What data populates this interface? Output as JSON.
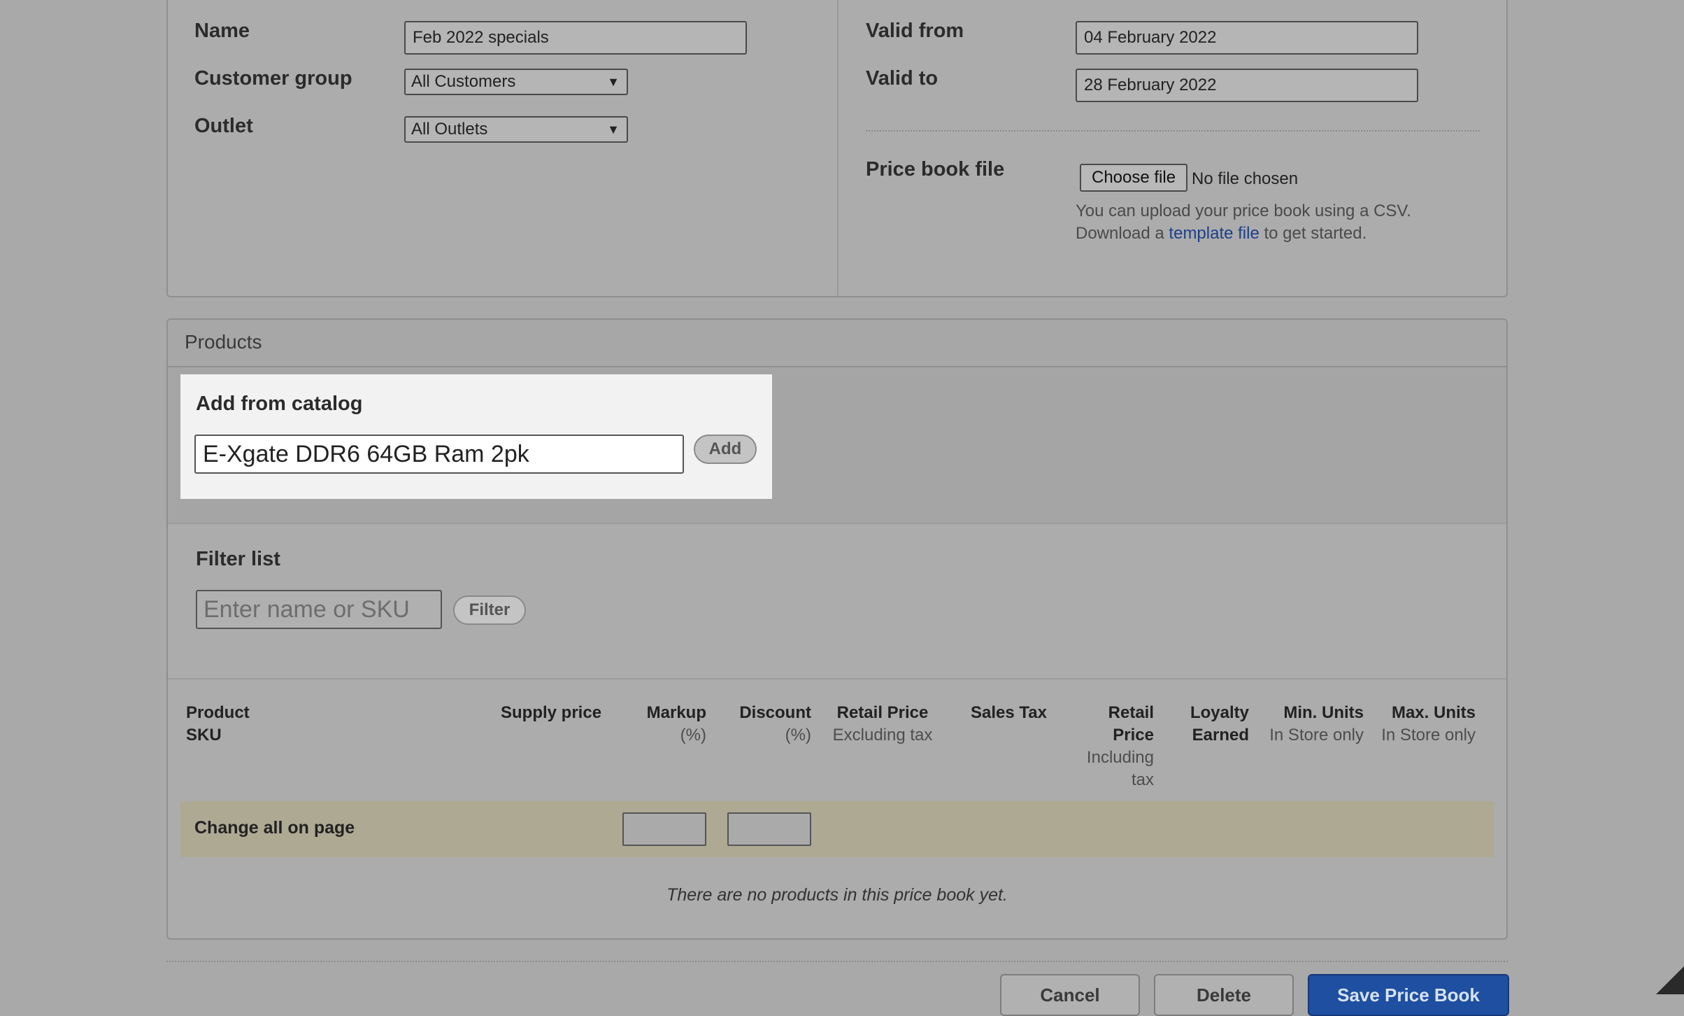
{
  "details": {
    "name_label": "Name",
    "name_value": "Feb 2022 specials",
    "customer_group_label": "Customer group",
    "customer_group_value": "All Customers",
    "outlet_label": "Outlet",
    "outlet_value": "All Outlets",
    "valid_from_label": "Valid from",
    "valid_from_value": "04 February 2022",
    "valid_to_label": "Valid to",
    "valid_to_value": "28 February 2022",
    "price_book_file_label": "Price book file",
    "choose_file_label": "Choose file",
    "file_status": "No file chosen",
    "hint_line1": "You can upload your price book using a CSV.",
    "hint_prefix": "Download a",
    "hint_link": "template file",
    "hint_suffix": "to get started."
  },
  "products": {
    "title": "Products",
    "add_from_catalog_title": "Add from catalog",
    "catalog_input_value": "E-Xgate DDR6 64GB Ram 2pk",
    "add_button": "Add",
    "filter_title": "Filter list",
    "filter_placeholder": "Enter name or SKU",
    "filter_button": "Filter",
    "columns": {
      "product": "Product",
      "sku": "SKU",
      "supply_price": "Supply price",
      "markup": "Markup",
      "markup_sub": "(%)",
      "discount": "Discount",
      "discount_sub": "(%)",
      "retail_price": "Retail Price",
      "retail_price_sub": "Excluding tax",
      "sales_tax": "Sales Tax",
      "retail_price_incl_1": "Retail",
      "retail_price_incl_2": "Price",
      "retail_price_incl_sub1": "Including",
      "retail_price_incl_sub2": "tax",
      "loyalty_1": "Loyalty",
      "loyalty_2": "Earned",
      "min_units": "Min. Units",
      "min_units_sub": "In Store only",
      "max_units": "Max. Units",
      "max_units_sub": "In Store only"
    },
    "change_all_label": "Change all on page",
    "empty_message": "There are no products in this price book yet."
  },
  "footer": {
    "cancel_button": "Cancel",
    "delete_button": "Delete",
    "save_button": "Save Price Book"
  }
}
